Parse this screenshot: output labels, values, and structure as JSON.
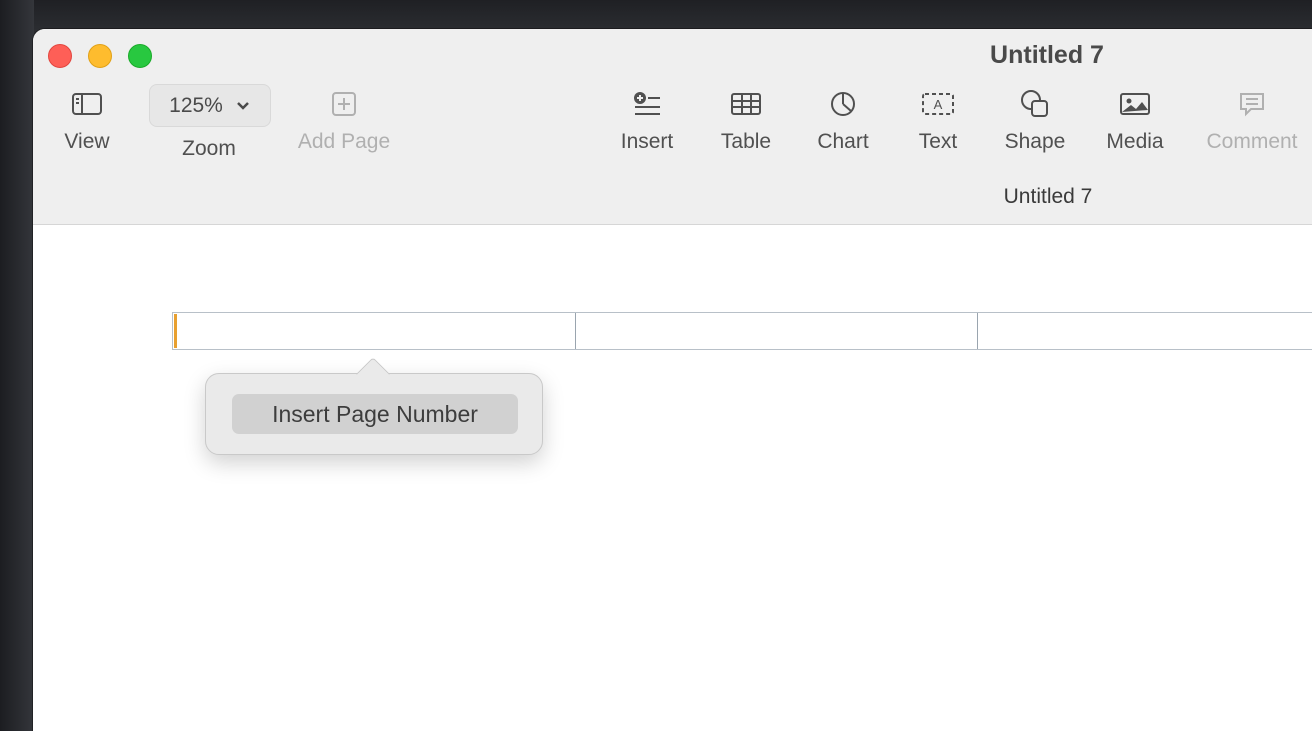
{
  "window": {
    "title": "Untitled 7",
    "subtitle": "Untitled 7"
  },
  "toolbar": {
    "view": {
      "label": "View",
      "icon": "sidebar-icon"
    },
    "zoom": {
      "label": "Zoom",
      "value": "125%",
      "icon": "chevron-down-icon"
    },
    "add_page": {
      "label": "Add Page",
      "icon": "add-page-icon",
      "enabled": false
    },
    "insert": {
      "label": "Insert",
      "icon": "insert-icon"
    },
    "table": {
      "label": "Table",
      "icon": "table-icon"
    },
    "chart": {
      "label": "Chart",
      "icon": "chart-icon"
    },
    "text": {
      "label": "Text",
      "icon": "text-box-icon"
    },
    "shape": {
      "label": "Shape",
      "icon": "shape-icon"
    },
    "media": {
      "label": "Media",
      "icon": "media-icon"
    },
    "comment": {
      "label": "Comment",
      "icon": "comment-icon",
      "enabled": false
    }
  },
  "popover": {
    "button_label": "Insert Page Number"
  },
  "colors": {
    "close": "#fe5f57",
    "minimize": "#febc2e",
    "maximize": "#28c840",
    "cursor": "#e8a030"
  }
}
